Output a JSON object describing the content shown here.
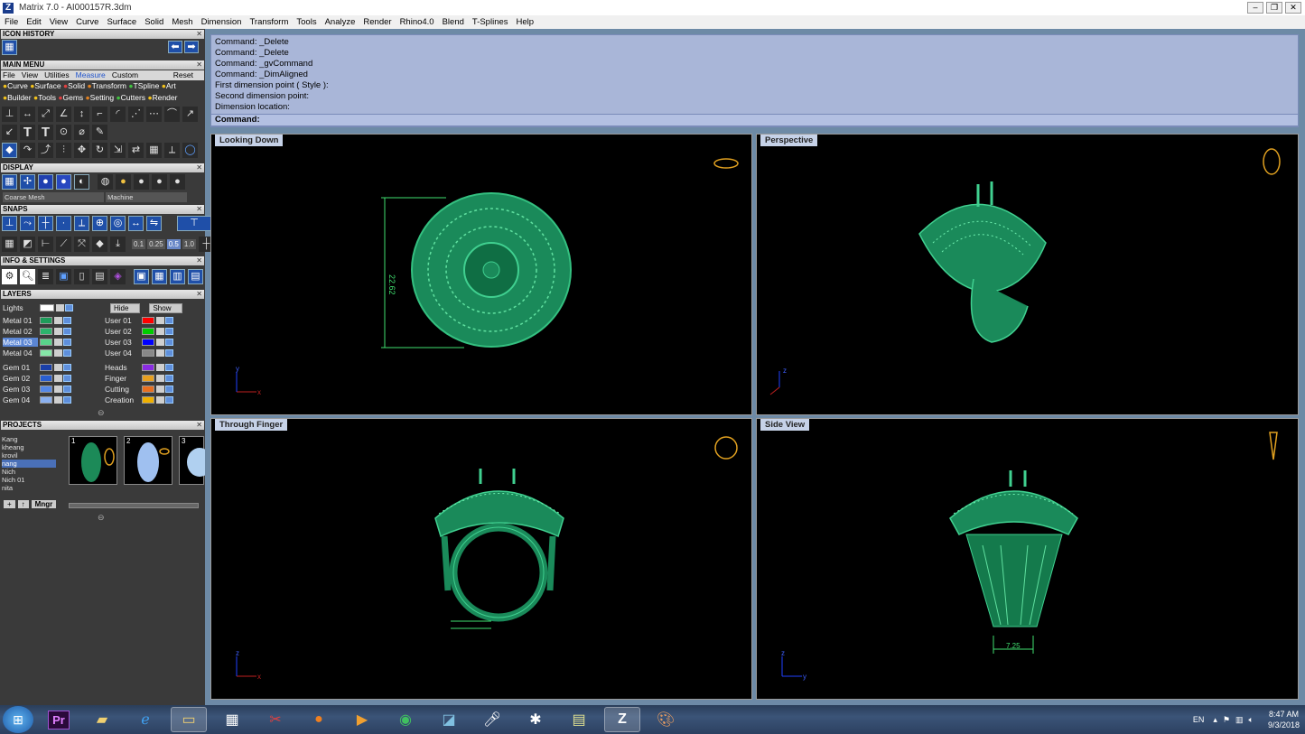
{
  "window": {
    "title": "Matrix 7.0 - AI000157R.3dm",
    "app_icon": "Z"
  },
  "menu": [
    "File",
    "Edit",
    "View",
    "Curve",
    "Surface",
    "Solid",
    "Mesh",
    "Dimension",
    "Transform",
    "Tools",
    "Analyze",
    "Render",
    "Rhino4.0",
    "Blend",
    "T-Splines",
    "Help"
  ],
  "panels": {
    "icon_history": "ICON HISTORY",
    "main_menu": "MAIN MENU",
    "main_tabs": [
      "File",
      "View",
      "Utilities",
      "Measure",
      "Custom"
    ],
    "reset": "Reset",
    "categories_row1": [
      "Curve",
      "Surface",
      "Solid",
      "Transform",
      "TSpline",
      "Art"
    ],
    "categories_row2": [
      "Builder",
      "Tools",
      "Gems",
      "Setting",
      "Cutters",
      "Render"
    ],
    "display": "DISPLAY",
    "display_mode1": "Coarse Mesh",
    "display_mode2": "Machine",
    "snaps": "SNAPS",
    "snap_values": [
      "0.1",
      "0.25",
      "0.5",
      "1.0"
    ],
    "info": "INFO & SETTINGS",
    "layers": "LAYERS",
    "lights": "Lights",
    "hide": "Hide",
    "show": "Show",
    "layer_left": [
      "Metal 01",
      "Metal 02",
      "Metal 03",
      "Metal 04"
    ],
    "layer_right": [
      "User 01",
      "User 02",
      "User 03",
      "User 04"
    ],
    "layer_left2": [
      "Gem 01",
      "Gem 02",
      "Gem 03",
      "Gem 04"
    ],
    "layer_right2": [
      "Heads",
      "Finger",
      "Cutting",
      "Creation"
    ],
    "projects": "PROJECTS",
    "project_list": [
      "Kang",
      "kheang",
      "krovil",
      "nang",
      "Nich",
      "Nich 01",
      "nita"
    ],
    "mngr": "Mngr",
    "thumb_nums": [
      "1",
      "2",
      "3"
    ]
  },
  "colors": {
    "left_swatches": [
      "#1e9c5a",
      "#2bb36c",
      "#59d38a",
      "#86e6a8"
    ],
    "right_swatches": [
      "#ff0000",
      "#00cc00",
      "#0000ff",
      "#888888"
    ],
    "left_swatches2": [
      "#1a3fa8",
      "#2a5ed0",
      "#5588e8",
      "#8ab0f0"
    ],
    "right_swatches2": [
      "#8a2be2",
      "#e8a020",
      "#e87020",
      "#f0b000"
    ]
  },
  "command": {
    "history": [
      "Command: _Delete",
      "Command: _Delete",
      "Command: _gvCommand",
      "Command: _DimAligned",
      "First dimension point ( Style ):",
      "Second dimension point:",
      "Dimension location:"
    ],
    "prompt": "Command:"
  },
  "viewports": {
    "top_left": {
      "label": "Looking Down",
      "dimension": "22.62",
      "axis_a": "y",
      "axis_b": "x"
    },
    "top_right": {
      "label": "Perspective",
      "axis_a": "z",
      "axis_b": "y",
      "axis_c": "x"
    },
    "bottom_left": {
      "label": "Through Finger",
      "axis_a": "z",
      "axis_b": "x"
    },
    "bottom_right": {
      "label": "Side View",
      "dimension": "7.25",
      "axis_a": "z",
      "axis_b": "y"
    }
  },
  "taskbar": {
    "lang": "EN",
    "time": "8:47 AM",
    "date": "9/3/2018",
    "pr_label": "Pr"
  }
}
